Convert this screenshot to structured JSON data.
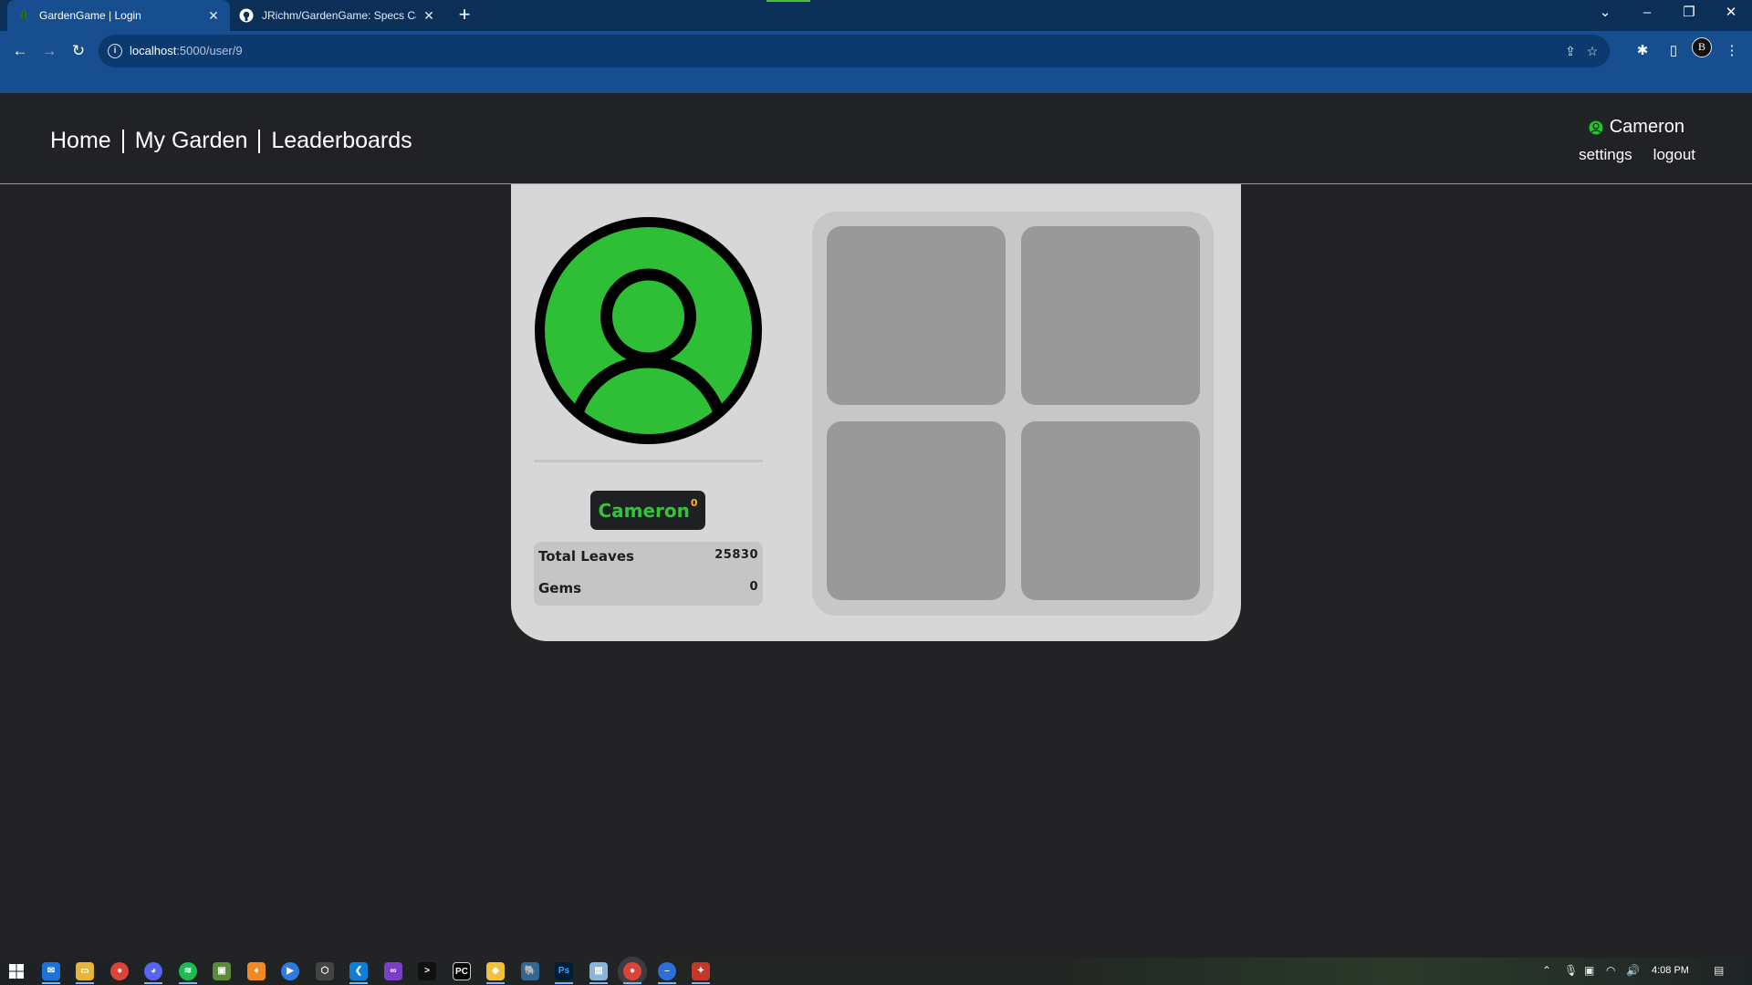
{
  "browser": {
    "tabs": [
      {
        "title": "GardenGame | Login",
        "active": true
      },
      {
        "title": "JRichm/GardenGame: Specs Cap",
        "active": false
      }
    ],
    "url_host": "localhost",
    "url_path": ":5000/user/9",
    "profile_initial": "B"
  },
  "site": {
    "nav": [
      "Home",
      "My Garden",
      "Leaderboards"
    ],
    "user": {
      "name": "Cameron",
      "settings_label": "settings",
      "logout_label": "logout"
    }
  },
  "profile": {
    "name": "Cameron",
    "level": "0",
    "stats": [
      {
        "label": "Total Leaves",
        "value": "25830"
      },
      {
        "label": "Gems",
        "value": "0"
      }
    ],
    "avatar_color": "#2ebf37"
  },
  "taskbar": {
    "time": "4:08 PM",
    "apps": [
      "windows-start",
      "mail",
      "file-explorer",
      "chrome",
      "discord",
      "spotify",
      "minecraft",
      "app-orange",
      "app-blue",
      "unity",
      "vscode",
      "visual-studio",
      "terminal",
      "pycharm",
      "git",
      "postgres",
      "photoshop",
      "notepad",
      "chrome-active",
      "app-blue-2",
      "app-red"
    ]
  }
}
